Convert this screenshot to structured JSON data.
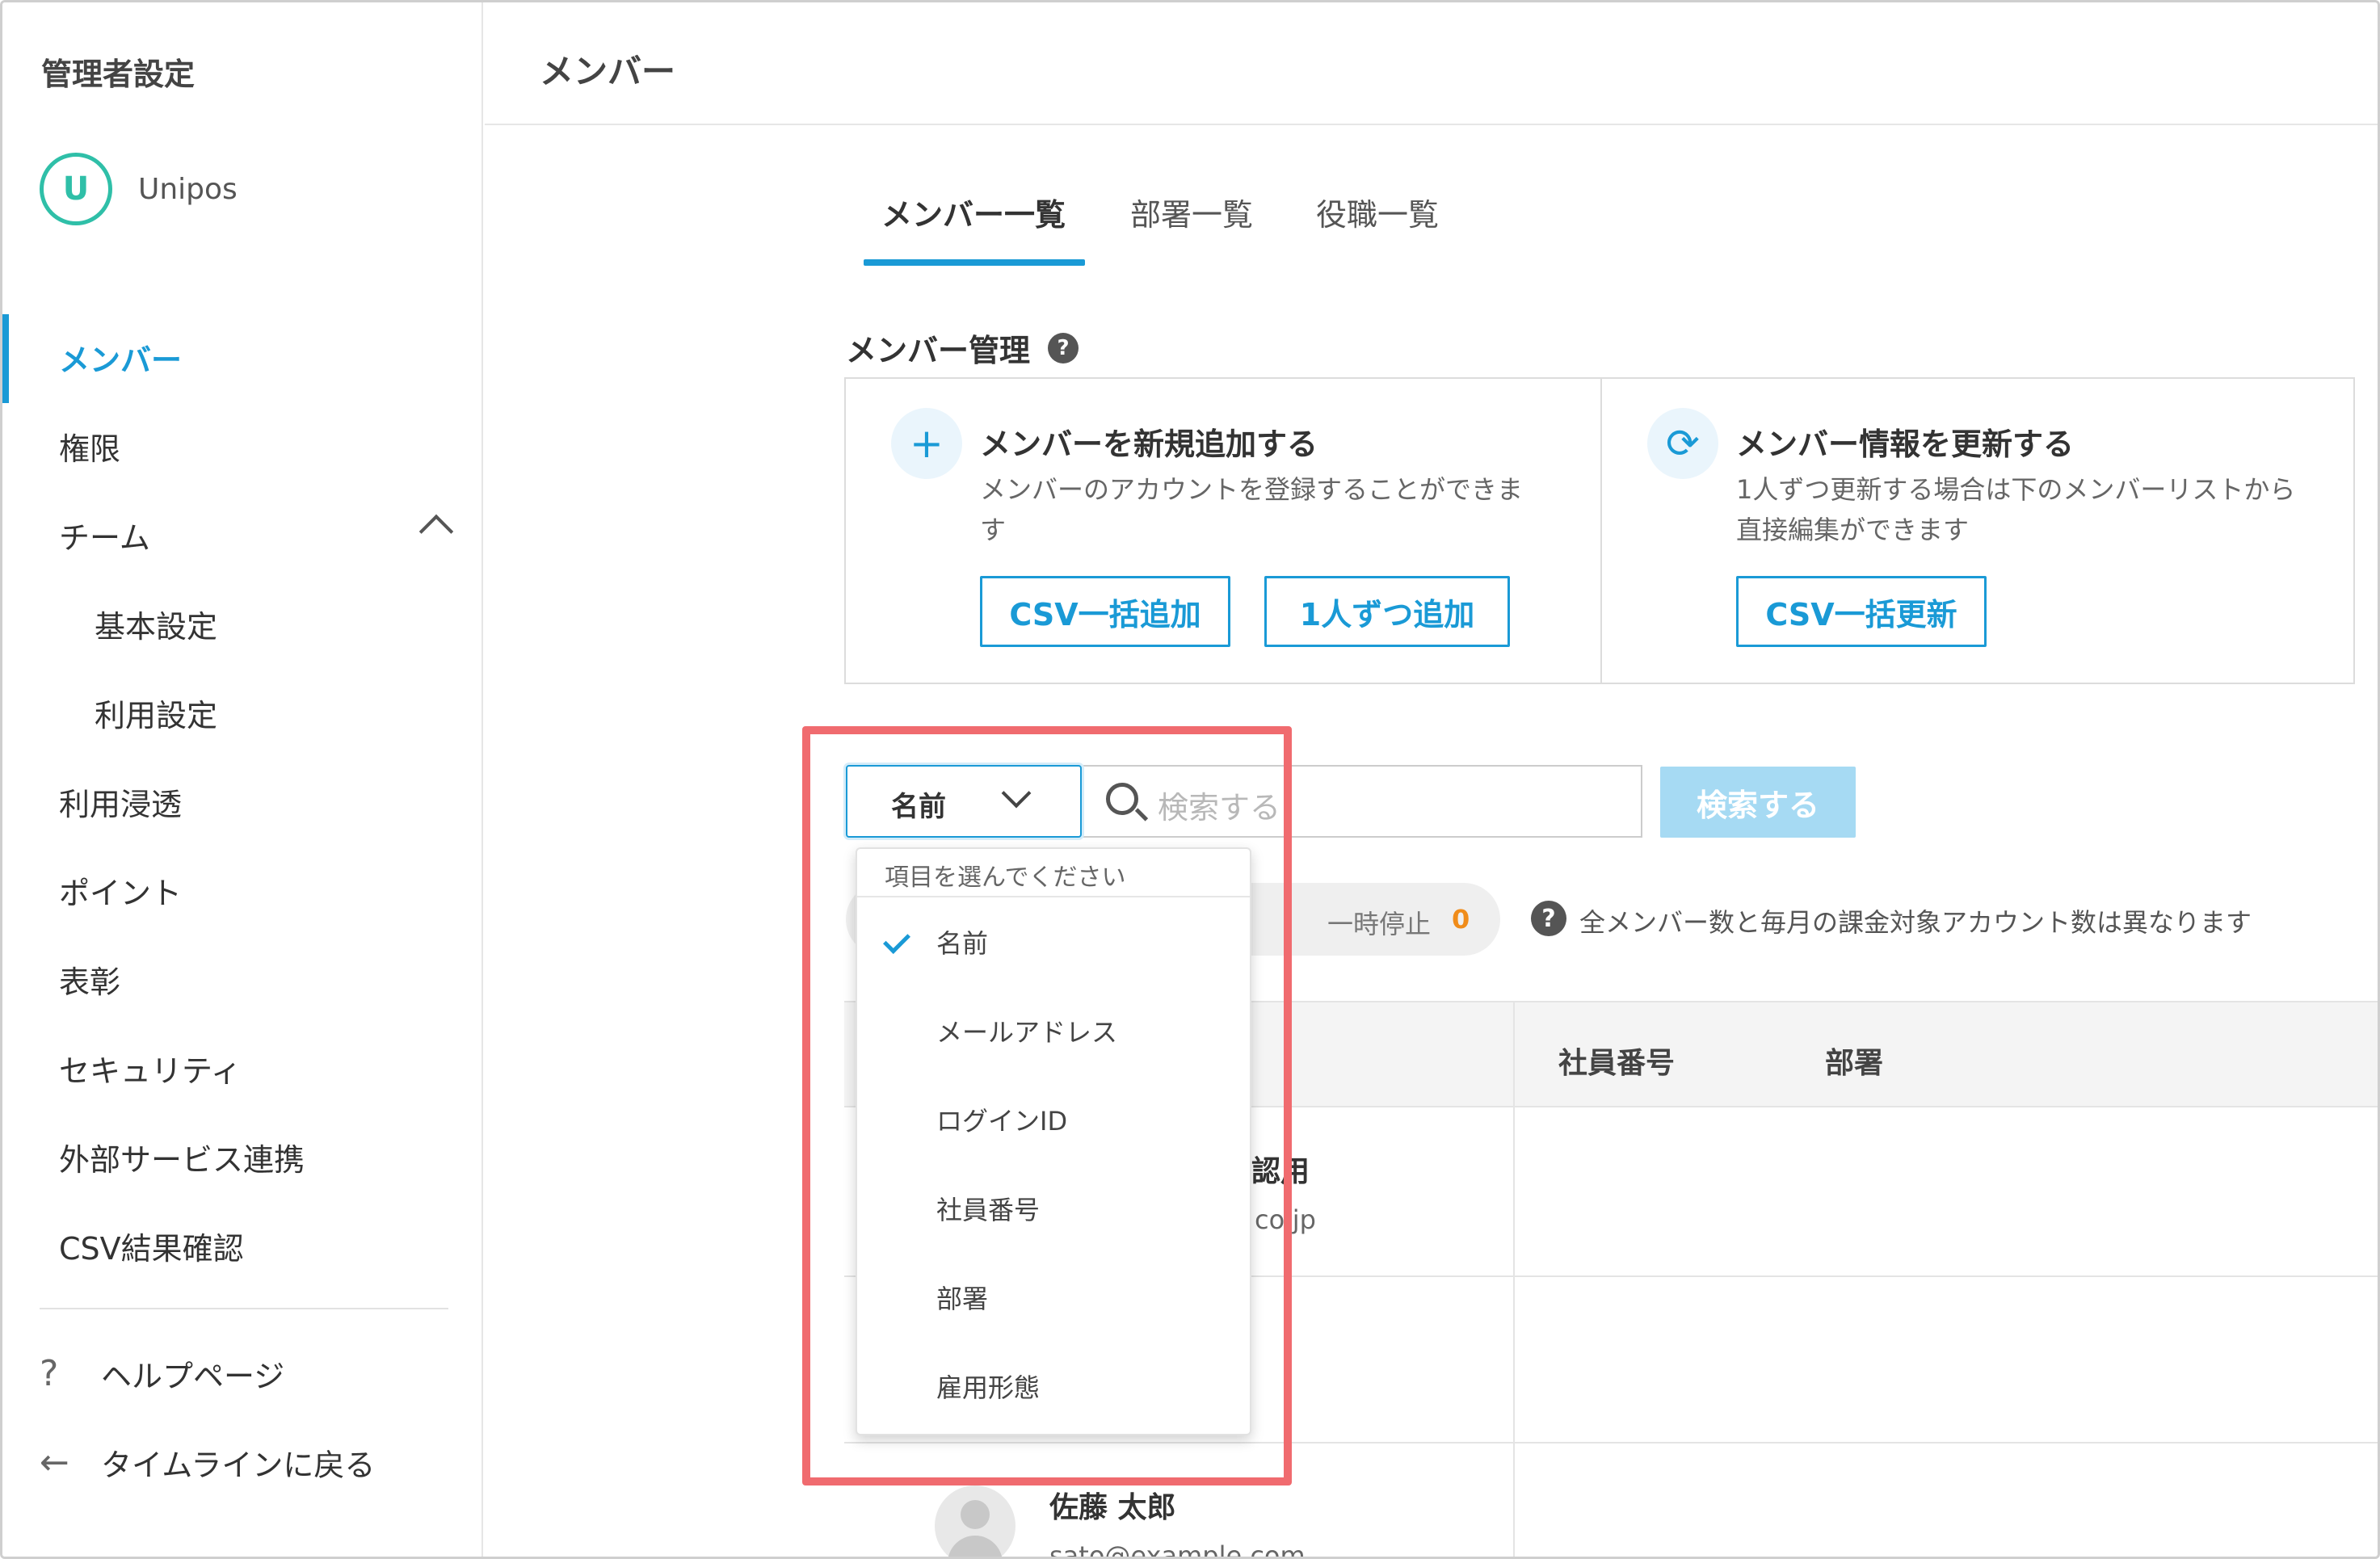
{
  "sidebar": {
    "title": "管理者設定",
    "org_logo": "U",
    "org_name": "Unipos",
    "items": [
      {
        "label": "メンバー"
      },
      {
        "label": "権限"
      },
      {
        "label": "チーム"
      },
      {
        "label": "基本設定"
      },
      {
        "label": "利用設定"
      },
      {
        "label": "利用浸透"
      },
      {
        "label": "ポイント"
      },
      {
        "label": "表彰"
      },
      {
        "label": "セキュリティ"
      },
      {
        "label": "外部サービス連携"
      },
      {
        "label": "CSV結果確認"
      }
    ],
    "footer": {
      "help_icon": "?",
      "help_label": "ヘルプページ",
      "back_icon": "←",
      "back_label": "タイムラインに戻る"
    }
  },
  "header": {
    "title": "メンバー"
  },
  "tabs": [
    "メンバー一覧",
    "部署一覧",
    "役職一覧"
  ],
  "section": {
    "title": "メンバー管理",
    "help": "?"
  },
  "cards": {
    "add": {
      "icon": "+",
      "title": "メンバーを新規追加する",
      "desc_line1": "メンバーのアカウントを登録することができま",
      "desc_line2": "す",
      "btn_csv": "CSV一括追加",
      "btn_single": "1人ずつ追加"
    },
    "update": {
      "icon": "⟳",
      "title": "メンバー情報を更新する",
      "desc_line1": "1人ずつ更新する場合は下のメンバーリストから",
      "desc_line2": "直接編集ができます",
      "btn_csv": "CSV一括更新"
    }
  },
  "search": {
    "select_value": "名前",
    "placeholder": "検索する",
    "button": "検索する"
  },
  "stats": {
    "paused_label": "一時停止",
    "paused_count": "0",
    "notice_icon": "?",
    "notice": "全メンバー数と毎月の課金対象アカウント数は異なります"
  },
  "table": {
    "headers": {
      "employee_no": "社員番号",
      "department": "部署"
    },
    "rows": [
      {
        "name_fragment": "認用",
        "email_fragment": "co.jp"
      },
      {
        "name": "佐藤 太郎",
        "email": "sato@example.com"
      }
    ]
  },
  "dropdown": {
    "header": "項目を選んでください",
    "options": [
      "名前",
      "メールアドレス",
      "ログインID",
      "社員番号",
      "部署",
      "雇用形態"
    ],
    "selected": "名前"
  },
  "colors": {
    "accent": "#1a9ad6",
    "highlight": "#f06b6f",
    "count": "#f08c1a"
  }
}
